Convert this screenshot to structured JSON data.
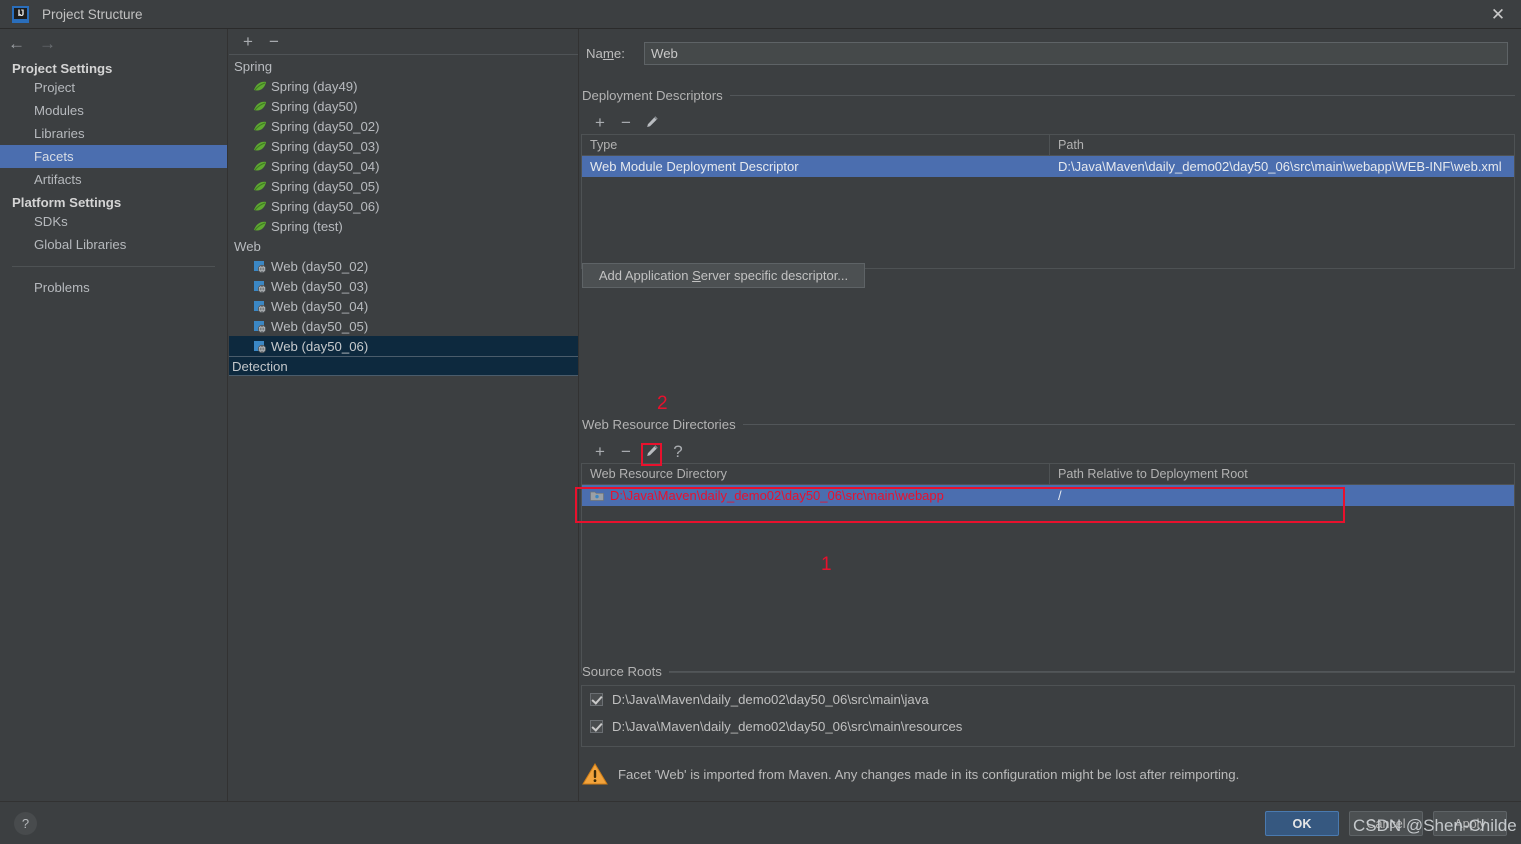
{
  "window": {
    "title": "Project Structure",
    "logo_text": "IJ",
    "close_icon": "close-icon"
  },
  "sidebar": {
    "back_icon": "arrow-left-icon",
    "forward_icon": "arrow-right-icon",
    "groups": [
      {
        "label": "Project Settings",
        "items": [
          {
            "label": "Project",
            "selected": false
          },
          {
            "label": "Modules",
            "selected": false
          },
          {
            "label": "Libraries",
            "selected": false
          },
          {
            "label": "Facets",
            "selected": true
          },
          {
            "label": "Artifacts",
            "selected": false
          }
        ]
      },
      {
        "label": "Platform Settings",
        "items": [
          {
            "label": "SDKs",
            "selected": false
          },
          {
            "label": "Global Libraries",
            "selected": false
          }
        ]
      }
    ],
    "problems_label": "Problems"
  },
  "facet_tree": {
    "toolbar": {
      "add_label": "+",
      "remove_label": "−"
    },
    "categories": [
      {
        "label": "Spring",
        "icon": "spring-leaf-icon",
        "nodes": [
          {
            "label": "Spring (day49)",
            "selected": false
          },
          {
            "label": "Spring (day50)",
            "selected": false
          },
          {
            "label": "Spring (day50_02)",
            "selected": false
          },
          {
            "label": "Spring (day50_03)",
            "selected": false
          },
          {
            "label": "Spring (day50_04)",
            "selected": false
          },
          {
            "label": "Spring (day50_05)",
            "selected": false
          },
          {
            "label": "Spring (day50_06)",
            "selected": false
          },
          {
            "label": "Spring (test)",
            "selected": false
          }
        ]
      },
      {
        "label": "Web",
        "icon": "web-facet-icon",
        "nodes": [
          {
            "label": "Web (day50_02)",
            "selected": false
          },
          {
            "label": "Web (day50_03)",
            "selected": false
          },
          {
            "label": "Web (day50_04)",
            "selected": false
          },
          {
            "label": "Web (day50_05)",
            "selected": false
          },
          {
            "label": "Web (day50_06)",
            "selected": true
          }
        ]
      }
    ],
    "footer_label": "Detection"
  },
  "facet_form": {
    "name_label_pre": "Na",
    "name_label_mnemonic": "m",
    "name_label_post": "e:",
    "name_value": "Web",
    "deployment_descriptors": {
      "title": "Deployment Descriptors",
      "toolbar": {
        "add": "+",
        "remove": "−",
        "edit": "pencil-icon"
      },
      "columns": [
        "Type",
        "Path"
      ],
      "rows": [
        {
          "type": "Web Module Deployment Descriptor",
          "path": "D:\\Java\\Maven\\daily_demo02\\day50_06\\src\\main\\webapp\\WEB-INF\\web.xml",
          "selected": true
        }
      ],
      "add_server_descriptor_button": {
        "pre": "Add Application ",
        "mnemonic": "S",
        "post": "erver specific descriptor..."
      }
    },
    "web_resource_directories": {
      "title": "Web Resource Directories",
      "toolbar": {
        "add": "+",
        "remove": "−",
        "edit": "pencil-icon",
        "help": "?"
      },
      "columns": [
        "Web Resource Directory",
        "Path Relative to Deployment Root"
      ],
      "rows": [
        {
          "directory": "D:\\Java\\Maven\\daily_demo02\\day50_06\\src\\main\\webapp",
          "relative_path": "/",
          "selected": true,
          "icon": "folder-icon"
        }
      ]
    },
    "source_roots": {
      "title": "Source Roots",
      "rows": [
        {
          "path": "D:\\Java\\Maven\\daily_demo02\\day50_06\\src\\main\\java",
          "checked": true
        },
        {
          "path": "D:\\Java\\Maven\\daily_demo02\\day50_06\\src\\main\\resources",
          "checked": true
        }
      ]
    },
    "warning": {
      "icon": "warning-triangle-icon",
      "text": "Facet 'Web' is imported from Maven. Any changes made in its configuration might be lost after reimporting."
    }
  },
  "footer": {
    "help_icon": "?",
    "buttons": [
      {
        "label": "OK",
        "style": "primary"
      },
      {
        "label": "Cancel",
        "style": "normal"
      },
      {
        "label": "Apply",
        "style": "normal"
      }
    ]
  },
  "annotations": {
    "marker_one": "1",
    "marker_two": "2",
    "accent_color": "#e8112d"
  },
  "watermark": {
    "text": "CSDN @Shen-Childe"
  }
}
